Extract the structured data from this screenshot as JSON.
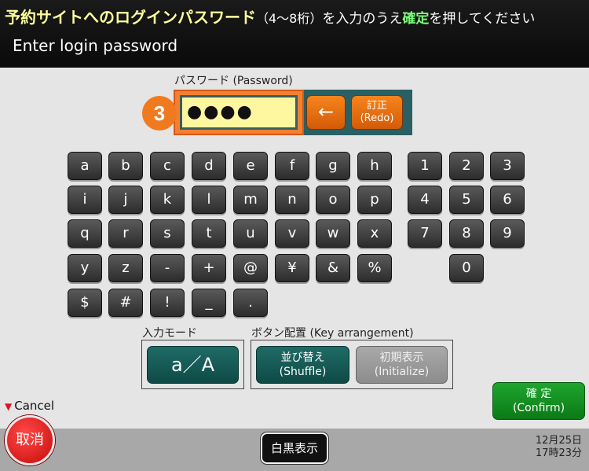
{
  "header": {
    "title_jp": "予約サイトへのログインパスワード",
    "title_jp_paren": "（4～8桁）",
    "title_jp_note1": "を入力のうえ",
    "title_jp_confirm": "確定",
    "title_jp_note2": "を押してください",
    "title_en": "Enter login password"
  },
  "password": {
    "label": "パスワード (Password)",
    "step": "3",
    "value": "●●●●",
    "backspace_label": "←",
    "redo_label_jp": "訂正",
    "redo_label_en": "(Redo)"
  },
  "keyboard": {
    "keys": [
      {
        "id": "key-a",
        "label": "a"
      },
      {
        "id": "key-b",
        "label": "b"
      },
      {
        "id": "key-c",
        "label": "c"
      },
      {
        "id": "key-d",
        "label": "d"
      },
      {
        "id": "key-e",
        "label": "e"
      },
      {
        "id": "key-f",
        "label": "f"
      },
      {
        "id": "key-g",
        "label": "g"
      },
      {
        "id": "key-h",
        "label": "h"
      },
      {
        "id": "key-i",
        "label": "i"
      },
      {
        "id": "key-j",
        "label": "j"
      },
      {
        "id": "key-k",
        "label": "k"
      },
      {
        "id": "key-l",
        "label": "l"
      },
      {
        "id": "key-m",
        "label": "m"
      },
      {
        "id": "key-n",
        "label": "n"
      },
      {
        "id": "key-o",
        "label": "o"
      },
      {
        "id": "key-p",
        "label": "p"
      },
      {
        "id": "key-q",
        "label": "q"
      },
      {
        "id": "key-r",
        "label": "r"
      },
      {
        "id": "key-s",
        "label": "s"
      },
      {
        "id": "key-t",
        "label": "t"
      },
      {
        "id": "key-u",
        "label": "u"
      },
      {
        "id": "key-v",
        "label": "v"
      },
      {
        "id": "key-w",
        "label": "w"
      },
      {
        "id": "key-x",
        "label": "x"
      },
      {
        "id": "key-y",
        "label": "y"
      },
      {
        "id": "key-z",
        "label": "z"
      },
      {
        "id": "key-minus",
        "label": "-"
      },
      {
        "id": "key-plus",
        "label": "+"
      },
      {
        "id": "key-at",
        "label": "@"
      },
      {
        "id": "key-yen",
        "label": "¥"
      },
      {
        "id": "key-ampersand",
        "label": "&"
      },
      {
        "id": "key-percent",
        "label": "%"
      },
      {
        "id": "key-dollar",
        "label": "$"
      },
      {
        "id": "key-hash",
        "label": "#"
      },
      {
        "id": "key-exclamation",
        "label": "!"
      },
      {
        "id": "key-underscore",
        "label": "_"
      },
      {
        "id": "key-period",
        "label": "."
      },
      {
        "id": "key-1",
        "label": "1"
      },
      {
        "id": "key-2",
        "label": "2"
      },
      {
        "id": "key-3",
        "label": "3"
      },
      {
        "id": "key-4",
        "label": "4"
      },
      {
        "id": "key-5",
        "label": "5"
      },
      {
        "id": "key-6",
        "label": "6"
      },
      {
        "id": "key-7",
        "label": "7"
      },
      {
        "id": "key-8",
        "label": "8"
      },
      {
        "id": "key-9",
        "label": "9"
      },
      {
        "id": "key-0",
        "label": "0"
      }
    ]
  },
  "input_mode": {
    "label": "入力モード",
    "button": "a／A"
  },
  "key_arrangement": {
    "label": "ボタン配置 (Key arrangement)",
    "shuffle_jp": "並び替え",
    "shuffle_en": "(Shuffle)",
    "initialize_jp": "初期表示",
    "initialize_en": "(Initialize)"
  },
  "confirm": {
    "label_jp": "確 定",
    "label_en": "(Confirm)"
  },
  "cancel": {
    "label": "Cancel",
    "button": "取消"
  },
  "footer": {
    "bw_button": "白黒表示",
    "date": "12月25日",
    "time": "17時23分"
  },
  "colors": {
    "header_bg": "#111111",
    "title_yellow": "#ffff9e",
    "confirm_green": "#1fa52e",
    "accent_orange": "#f07a20",
    "teal": "#1f6b66",
    "cancel_red": "#e0141e"
  }
}
